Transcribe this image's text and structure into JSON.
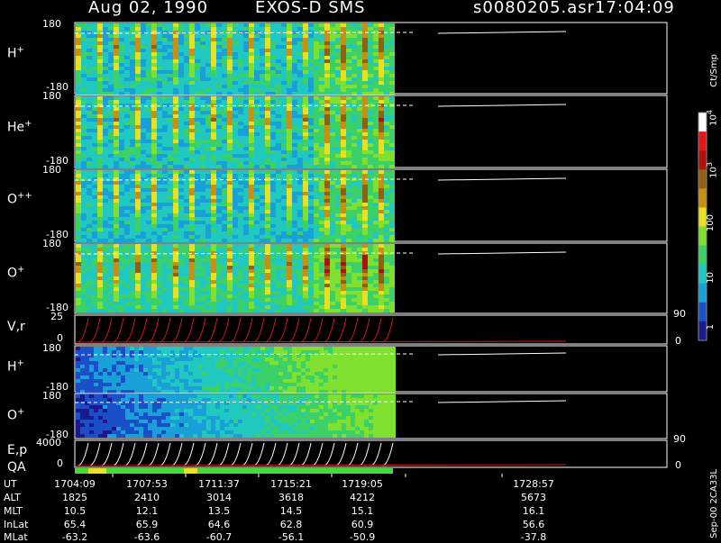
{
  "header": {
    "date": "Aug 02, 1990",
    "mission": "EXOS-D SMS",
    "file": "s0080205.asr",
    "time": "17:04:09"
  },
  "colorbar": {
    "unit_label": "Ct/Smp",
    "labels": [
      "1",
      "10",
      "100",
      "10",
      "10"
    ],
    "label_exponents": [
      "",
      "",
      "",
      "3",
      "4"
    ]
  },
  "panels": [
    {
      "name": "H",
      "charge": "+",
      "ymax": "180",
      "ymin": "-180"
    },
    {
      "name": "He",
      "charge": "+",
      "ymax": "180",
      "ymin": "-180"
    },
    {
      "name": "O",
      "charge": "++",
      "ymax": "180",
      "ymin": "-180"
    },
    {
      "name": "O",
      "charge": "+",
      "ymax": "180",
      "ymin": "-180"
    },
    {
      "name": "V,r",
      "charge": "",
      "ymax": "25",
      "ymin": "0",
      "rmax": "90",
      "rmin": "0"
    },
    {
      "name": "H",
      "charge": "+",
      "ymax": "180",
      "ymin": "-180"
    },
    {
      "name": "O",
      "charge": "+",
      "ymax": "180",
      "ymin": "-180"
    },
    {
      "name": "E,p",
      "charge": "",
      "ymax": "4000",
      "ymin": "0",
      "rmax": "90",
      "rmin": "0"
    }
  ],
  "qa_label": "QA",
  "footer_code": "Sep-00 2CA33L",
  "ephemeris": {
    "labels": [
      "UT",
      "ALT",
      "MLT",
      "InLat",
      "MLat"
    ],
    "columns": [
      [
        "1704:09",
        "1825",
        "10.5",
        "65.4",
        "-63.2"
      ],
      [
        "1707:53",
        "2410",
        "12.1",
        "65.9",
        "-63.6"
      ],
      [
        "1711:37",
        "3014",
        "13.5",
        "64.6",
        "-60.7"
      ],
      [
        "1715:21",
        "3618",
        "14.5",
        "62.8",
        "-56.1"
      ],
      [
        "1719:05",
        "4212",
        "15.1",
        "60.9",
        "-50.9"
      ],
      [
        "1728:57",
        "5673",
        "16.1",
        "56.6",
        "-37.8"
      ]
    ]
  },
  "chart_data": {
    "type": "heatmap",
    "x_axis": "UT",
    "x_ticks": [
      "1704:09",
      "1707:53",
      "1711:37",
      "1715:21",
      "1719:05",
      "1728:57"
    ],
    "data_end_ut": "1719:05",
    "color_scale": "log",
    "color_range": [
      1,
      10000
    ],
    "panels": [
      {
        "label": "H+",
        "ylim": [
          -180,
          180
        ]
      },
      {
        "label": "He+",
        "ylim": [
          -180,
          180
        ]
      },
      {
        "label": "O++",
        "ylim": [
          -180,
          180
        ]
      },
      {
        "label": "O+",
        "ylim": [
          -180,
          180
        ]
      },
      {
        "label": "V,r",
        "ylim": [
          0,
          25
        ],
        "right_ylim": [
          0,
          90
        ]
      },
      {
        "label": "H+",
        "ylim": [
          -180,
          180
        ]
      },
      {
        "label": "O+",
        "ylim": [
          -180,
          180
        ]
      },
      {
        "label": "E,p",
        "ylim": [
          0,
          4000
        ],
        "right_ylim": [
          0,
          90
        ]
      }
    ],
    "colors": [
      "#1a1a8c",
      "#1a4fc8",
      "#1aa0d8",
      "#20c8c0",
      "#3cd068",
      "#80e030",
      "#e8e020",
      "#c89010",
      "#906010",
      "#b01010",
      "#e01818",
      "#ffffff"
    ]
  }
}
